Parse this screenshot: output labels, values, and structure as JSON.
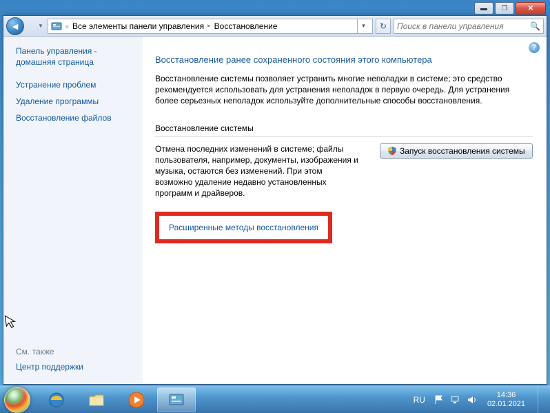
{
  "caption": {
    "min": "▁",
    "max": "▢",
    "close": "✕"
  },
  "nav": {
    "back": "←",
    "fwd": "→"
  },
  "breadcrumb": {
    "item1": "Все элементы панели управления",
    "item2": "Восстановление"
  },
  "search": {
    "placeholder": "Поиск в панели управления"
  },
  "sidebar": {
    "home": "Панель управления - домашняя страница",
    "links": [
      "Устранение проблем",
      "Удаление программы",
      "Восстановление файлов"
    ],
    "see_also_hdr": "См. также",
    "see_also": "Центр поддержки"
  },
  "main": {
    "title": "Восстановление ранее сохраненного состояния этого компьютера",
    "desc": "Восстановление системы позволяет устранить многие неполадки в системе; это средство рекомендуется использовать для устранения неполадок в первую очередь. Для устранения более серьезных неполадок используйте дополнительные способы восстановления.",
    "section_title": "Восстановление системы",
    "restore_text": "Отмена последних изменений в системе; файлы пользователя, например, документы, изображения и музыка, остаются без изменений. При этом возможно удаление недавно установленных программ и драйверов.",
    "restore_btn": "Запуск восстановления системы",
    "adv_link": "Расширенные методы восстановления"
  },
  "taskbar": {
    "lang": "RU",
    "time": "14:36",
    "date": "02.01.2021"
  }
}
